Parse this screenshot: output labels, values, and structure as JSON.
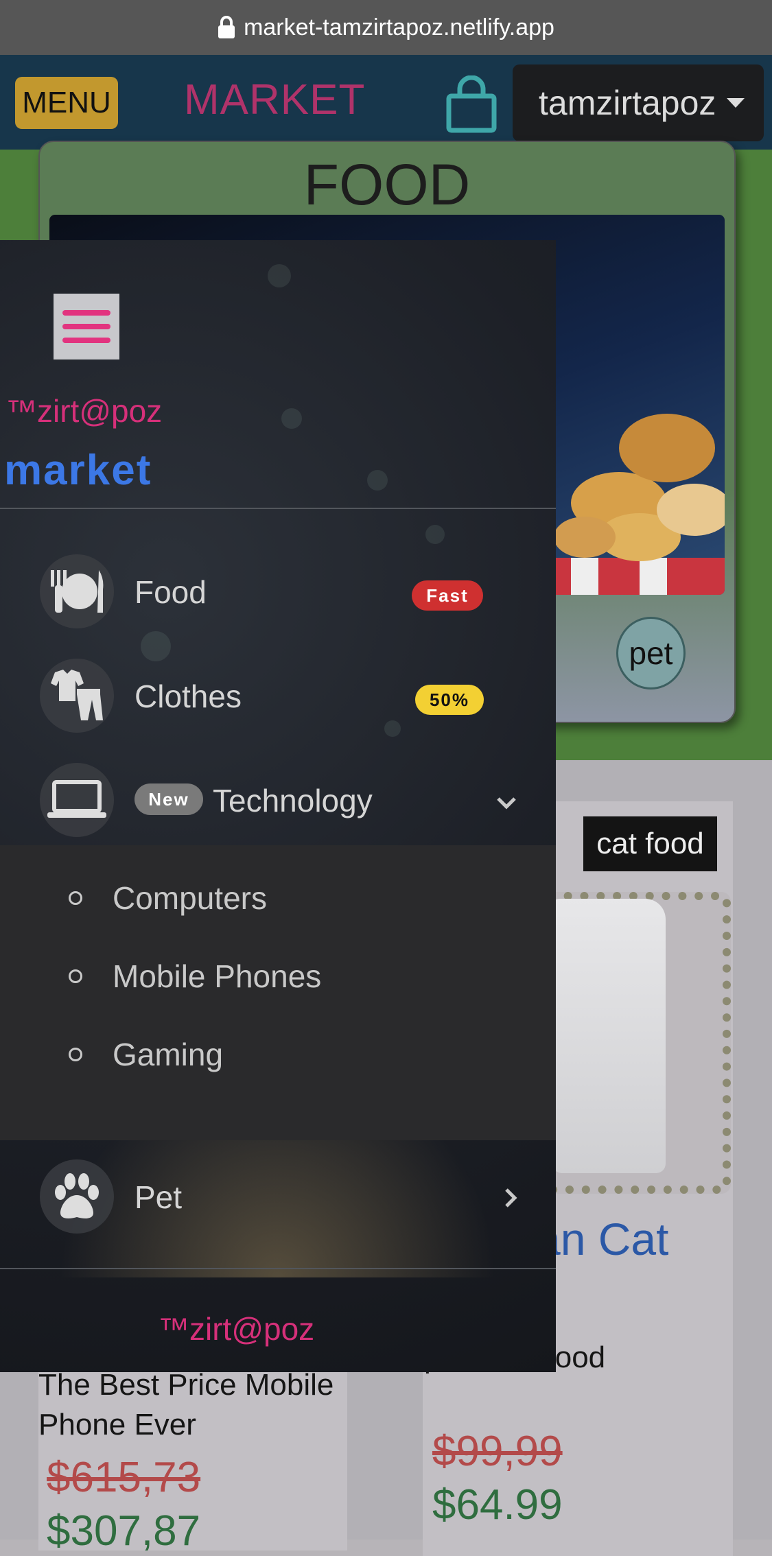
{
  "browser": {
    "url": "market-tamzirtapoz.netlify.app"
  },
  "navbar": {
    "menu_label": "MENU",
    "brand": "MARKET",
    "user": "tamzirtapoz"
  },
  "background": {
    "food_card_title": "FOOD",
    "pet_pill": "pet",
    "cat_tag": "cat food",
    "cat_name_partial": "an Cat",
    "desc_right": "price cat food",
    "desc_left": "The Best Price Mobile Phone Ever",
    "price_right_old": "$99,99",
    "price_right_new": "$64.99",
    "price_left_old": "$615,73",
    "price_left_new": "$307,87"
  },
  "sidebar": {
    "tm": "™zirt@poz",
    "market": "market",
    "items": [
      {
        "label": "Food",
        "icon": "utensils-icon",
        "badge": "Fast"
      },
      {
        "label": "Clothes",
        "icon": "shirt-icon",
        "badge": "50%"
      },
      {
        "label": "Technology",
        "icon": "laptop-icon",
        "badge": "New"
      },
      {
        "label": "Pet",
        "icon": "paw-icon"
      }
    ],
    "technology_sub": [
      "Computers",
      "Mobile Phones",
      "Gaming"
    ],
    "footer": "™zirt@poz"
  },
  "colors": {
    "accent_pink": "#d6307a",
    "accent_blue": "#3c78e6",
    "badge_red": "#cf3030",
    "badge_yellow": "#f3d033"
  }
}
